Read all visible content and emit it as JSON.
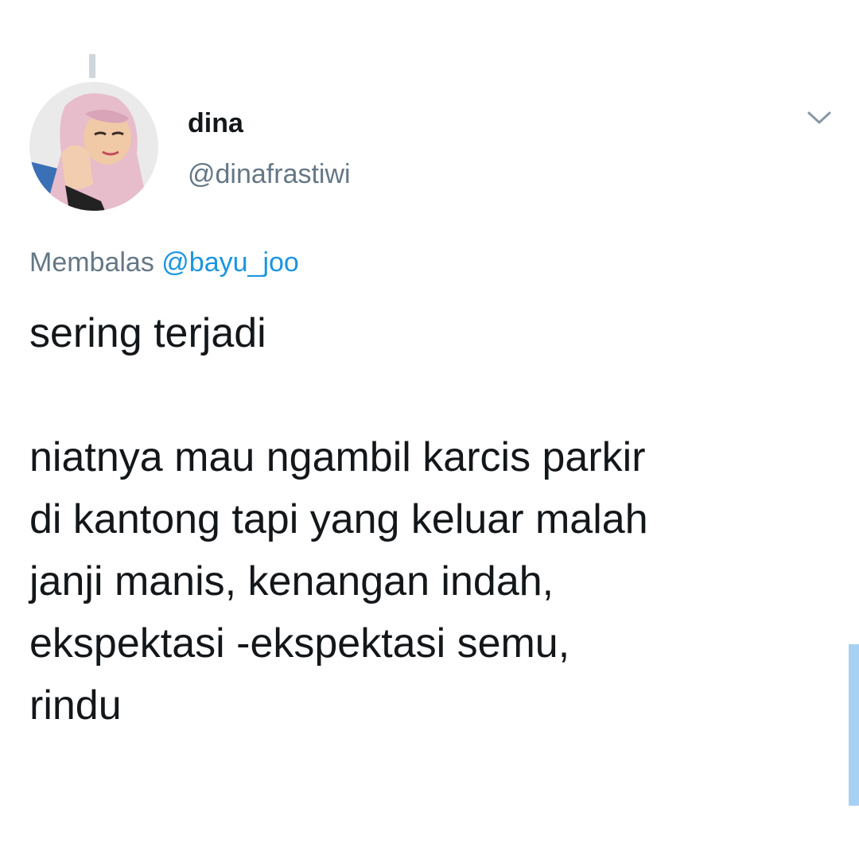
{
  "tweet": {
    "author": {
      "display_name": "dina",
      "handle": "@dinafrastiwi",
      "avatar_icon": "user-avatar-photo"
    },
    "reply_context": {
      "prefix": "Membalas",
      "mention": "@bayu_joo"
    },
    "text_paragraph_1": "sering terjadi",
    "text_paragraph_2": "niatnya mau ngambil karcis parkir\ndi kantong tapi yang keluar malah\njanji manis, kenangan indah,\nekspektasi -ekspektasi semu,\nrindu",
    "more_icon": "chevron-down-icon"
  },
  "colors": {
    "text_primary": "#14171a",
    "text_secondary": "#657786",
    "link": "#1b95e0",
    "thread_line": "#cfd6dc",
    "scroll_indicator": "#a7d1f2"
  }
}
